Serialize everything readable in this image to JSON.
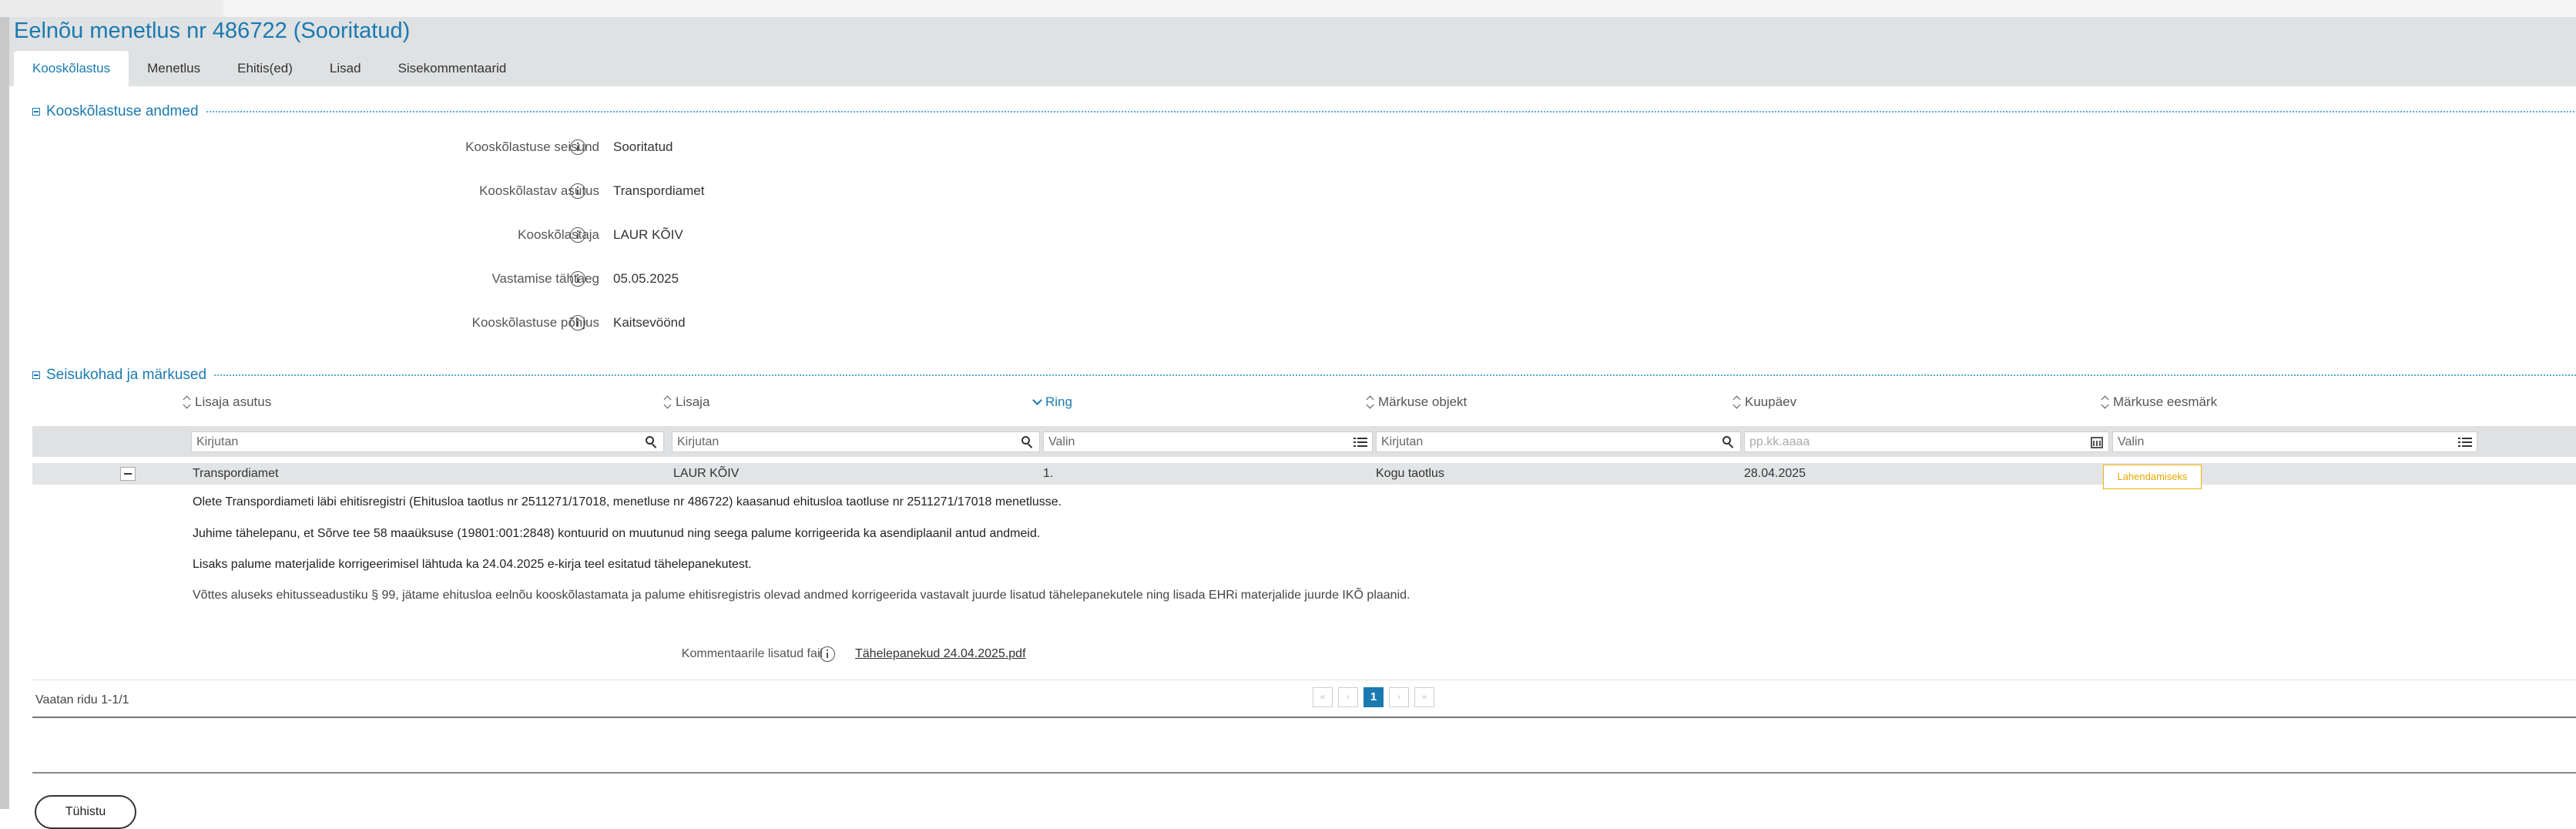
{
  "page": {
    "title": "Eelnõu menetlus nr 486722 (Sooritatud)"
  },
  "tabs": [
    {
      "label": "Kooskõlastus",
      "active": true
    },
    {
      "label": "Menetlus"
    },
    {
      "label": "Ehitis(ed)"
    },
    {
      "label": "Lisad"
    },
    {
      "label": "Sisekommentaarid"
    }
  ],
  "details": {
    "section_title": "Kooskõlastuse andmed",
    "fields": [
      {
        "label": "Kooskõlastuse seisund",
        "value": "Sooritatud"
      },
      {
        "label": "Kooskõlastav asutus",
        "value": "Transpordiamet"
      },
      {
        "label": "Kooskõlastaja",
        "value": "LAUR KÕIV"
      },
      {
        "label": "Vastamise tähtaeg",
        "value": "05.05.2025"
      },
      {
        "label": "Kooskõlastuse põhjus",
        "value": "Kaitsevöönd"
      }
    ]
  },
  "remarks": {
    "section_title": "Seisukohad ja märkused",
    "columns": [
      "Lisaja asutus",
      "Lisaja",
      "Ring",
      "Märkuse objekt",
      "Kuupäev",
      "Märkuse eesmärk"
    ],
    "filters": {
      "lisaja_asutus": "Kirjutan",
      "lisaja": "Kirjutan",
      "ring": "Valin",
      "objekt": "Kirjutan",
      "kuupaev_placeholder": "pp.kk.aaaa",
      "eesmark": "Valin"
    },
    "row": {
      "lisaja_asutus": "Transpordiamet",
      "lisaja": "LAUR KÕIV",
      "ring": "1.",
      "objekt": "Kogu taotlus",
      "kuupaev": "28.04.2025",
      "eesmark": "Lahendamiseks"
    },
    "comment_lines": [
      "Olete Transpordiameti läbi ehitisregistri (Ehitusloa taotlus nr 2511271/17018, menetluse nr 486722) kaasanud ehitusloa taotluse nr 2511271/17018 menetlusse.",
      "Juhime tähelepanu, et Sõrve tee 58 maaüksuse (19801:001:2848) kontuurid on muutunud ning seega palume korrigeerida ka asendiplaanil antud andmeid.",
      "Lisaks palume materjalide korrigeerimisel lähtuda ka 24.04.2025 e-kirja teel esitatud tähelepanekutest.",
      "Võttes aluseks ehitusseadustiku § 99, jätame ehitusloa eelnõu kooskõlastamata ja palume ehitisregistris olevad andmed korrigeerida vastavalt juurde lisatud tähelepanekutele ning lisada EHRi materjalide juurde IKÕ plaanid."
    ],
    "attachment": {
      "label": "Kommentaarile lisatud fail",
      "file": "Tähelepanekud 24.04.2025.pdf"
    },
    "pager": {
      "info": "Vaatan ridu 1-1/1",
      "current": "1"
    }
  },
  "footer": {
    "back_label": "Tühistu"
  }
}
